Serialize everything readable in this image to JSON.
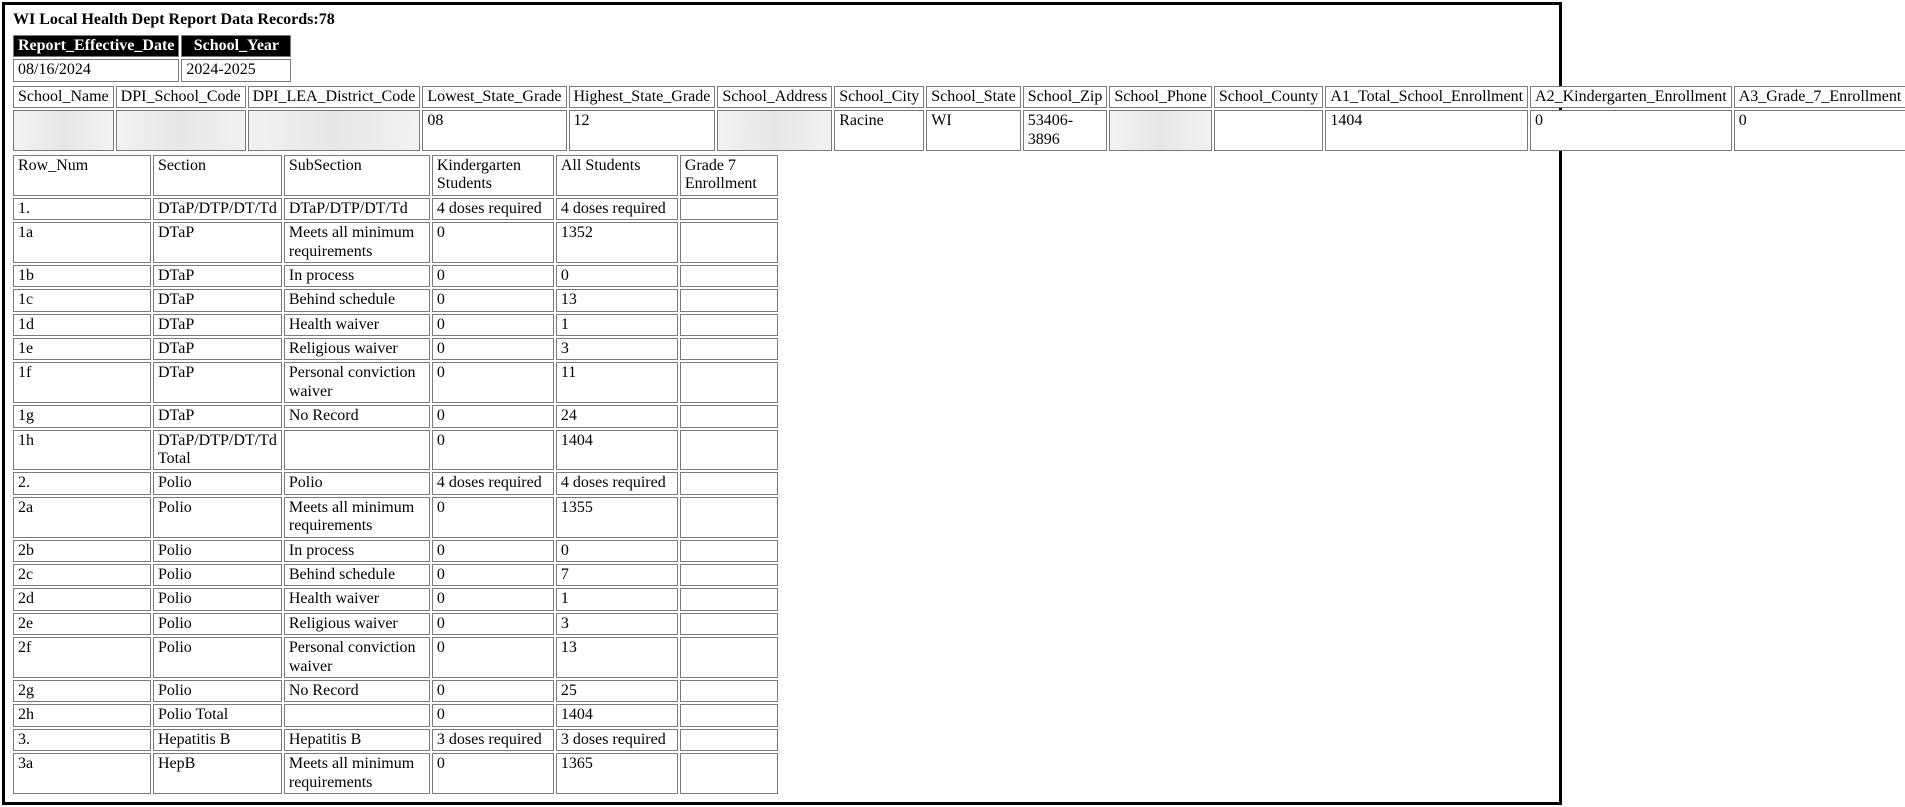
{
  "title": "WI Local Health Dept Report Data Records:78",
  "header": {
    "cols": [
      "Report_Effective_Date",
      "School_Year"
    ],
    "vals": [
      "08/16/2024",
      "2024-2025"
    ]
  },
  "school": {
    "cols": [
      "School_Name",
      "DPI_School_Code",
      "DPI_LEA_District_Code",
      "Lowest_State_Grade",
      "Highest_State_Grade",
      "School_Address",
      "School_City",
      "School_State",
      "School_Zip",
      "School_Phone",
      "School_County",
      "A1_Total_School_Enrollment",
      "A2_Kindergarten_Enrollment",
      "A3_Grade_7_Enrollment"
    ],
    "vals": [
      "",
      "",
      "",
      "08",
      "12",
      "",
      "Racine",
      "WI",
      "53406-3896",
      "",
      "",
      "1404",
      "0",
      "0"
    ],
    "redacted": [
      true,
      true,
      true,
      false,
      false,
      true,
      false,
      false,
      false,
      true,
      false,
      false,
      false,
      false
    ]
  },
  "detail": {
    "cols": [
      "Row_Num",
      "Section",
      "SubSection",
      "Kindergarten Students",
      "All Students",
      "Grade 7 Enrollment"
    ],
    "rows": [
      [
        "1.",
        "DTaP/DTP/DT/Td",
        "DTaP/DTP/DT/Td",
        "4 doses required",
        "4 doses required",
        ""
      ],
      [
        "1a",
        "DTaP",
        "Meets all minimum requirements",
        "0",
        "1352",
        ""
      ],
      [
        "1b",
        "DTaP",
        "In process",
        "0",
        "0",
        ""
      ],
      [
        "1c",
        "DTaP",
        "Behind schedule",
        "0",
        "13",
        ""
      ],
      [
        "1d",
        "DTaP",
        "Health waiver",
        "0",
        "1",
        ""
      ],
      [
        "1e",
        "DTaP",
        "Religious waiver",
        "0",
        "3",
        ""
      ],
      [
        "1f",
        "DTaP",
        "Personal conviction waiver",
        "0",
        "11",
        ""
      ],
      [
        "1g",
        "DTaP",
        "No Record",
        "0",
        "24",
        ""
      ],
      [
        "1h",
        "DTaP/DTP/DT/Td Total",
        "",
        "0",
        "1404",
        ""
      ],
      [
        "2.",
        "Polio",
        "Polio",
        "4 doses required",
        "4 doses required",
        ""
      ],
      [
        "2a",
        "Polio",
        "Meets all minimum requirements",
        "0",
        "1355",
        ""
      ],
      [
        "2b",
        "Polio",
        "In process",
        "0",
        "0",
        ""
      ],
      [
        "2c",
        "Polio",
        "Behind schedule",
        "0",
        "7",
        ""
      ],
      [
        "2d",
        "Polio",
        "Health waiver",
        "0",
        "1",
        ""
      ],
      [
        "2e",
        "Polio",
        "Religious waiver",
        "0",
        "3",
        ""
      ],
      [
        "2f",
        "Polio",
        "Personal conviction waiver",
        "0",
        "13",
        ""
      ],
      [
        "2g",
        "Polio",
        "No Record",
        "0",
        "25",
        ""
      ],
      [
        "2h",
        "Polio Total",
        "",
        "0",
        "1404",
        ""
      ],
      [
        "3.",
        "Hepatitis B",
        "Hepatitis B",
        "3 doses required",
        "3 doses required",
        ""
      ],
      [
        "3a",
        "HepB",
        "Meets all minimum requirements",
        "0",
        "1365",
        ""
      ]
    ]
  }
}
